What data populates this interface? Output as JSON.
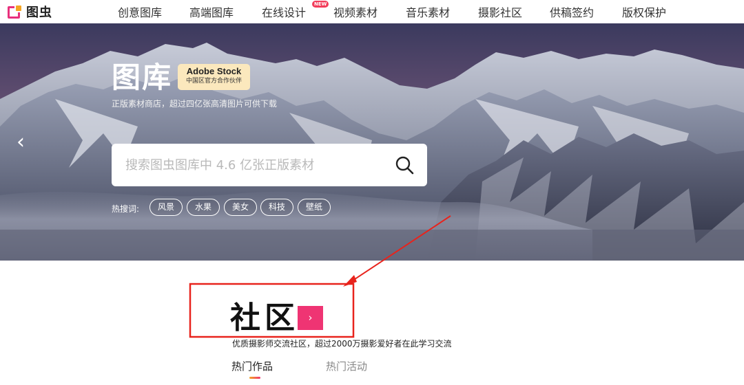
{
  "logo": {
    "text": "图虫"
  },
  "nav": {
    "items": [
      {
        "label": "创意图库"
      },
      {
        "label": "高端图库"
      },
      {
        "label": "在线设计",
        "badge": "NEW"
      },
      {
        "label": "视频素材"
      },
      {
        "label": "音乐素材"
      },
      {
        "label": "摄影社区"
      },
      {
        "label": "供稿签约"
      },
      {
        "label": "版权保护"
      }
    ]
  },
  "hero": {
    "title": "图库",
    "badge_line1": "Adobe Stock",
    "badge_line2": "中国区官方合作伙伴",
    "subtitle": "正版素材商店，超过四亿张高清图片可供下载",
    "search_placeholder": "搜索图虫图库中 4.6 亿张正版素材",
    "hot_label": "热搜词:",
    "hot_tags": [
      "风景",
      "水果",
      "美女",
      "科技",
      "壁纸"
    ]
  },
  "community": {
    "title": "社区",
    "go_glyph": "›",
    "description": "优质摄影师交流社区，超过2000万摄影爱好者在此学习交流",
    "tabs": [
      {
        "label": "热门作品",
        "active": true
      },
      {
        "label": "热门活动",
        "active": false
      }
    ]
  },
  "colors": {
    "brand_pink": "#ef3473",
    "brand_orange": "#f5a623",
    "badge_cream": "#fbe8bd",
    "annotation_red": "#e8231c"
  },
  "icons": {
    "search": "search-icon",
    "prev": "chevron-left-icon",
    "go": "chevron-right-icon"
  }
}
